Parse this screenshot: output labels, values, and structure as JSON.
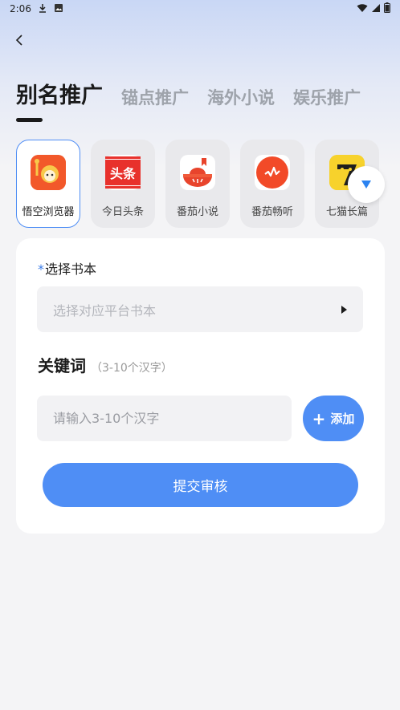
{
  "status_bar": {
    "time": "2:06"
  },
  "tabs": [
    {
      "label": "别名推广",
      "active": true
    },
    {
      "label": "锚点推广",
      "active": false
    },
    {
      "label": "海外小说",
      "active": false
    },
    {
      "label": "娱乐推广",
      "active": false
    }
  ],
  "apps": [
    {
      "label": "悟空浏览器",
      "icon": "wukong-browser-icon",
      "selected": true
    },
    {
      "label": "今日头条",
      "icon": "toutiao-icon",
      "selected": false
    },
    {
      "label": "番茄小说",
      "icon": "fanqie-novel-icon",
      "selected": false
    },
    {
      "label": "番茄畅听",
      "icon": "fanqie-listen-icon",
      "selected": false
    },
    {
      "label": "七猫长篇",
      "icon": "qimao-icon",
      "selected": false
    }
  ],
  "toutiao_logo_text": "头条",
  "form": {
    "required_mark": "*",
    "book_label": "选择书本",
    "book_placeholder": "选择对应平台书本",
    "keyword_title": "关键词",
    "keyword_hint": "（3-10个汉字）",
    "keyword_placeholder": "请输入3-10个汉字",
    "add_plus": "+",
    "add_label": "添加",
    "submit_label": "提交审核"
  },
  "colors": {
    "accent": "#4f8ef5",
    "page_bg": "#f4f4f6",
    "card_bg": "#ffffff"
  }
}
